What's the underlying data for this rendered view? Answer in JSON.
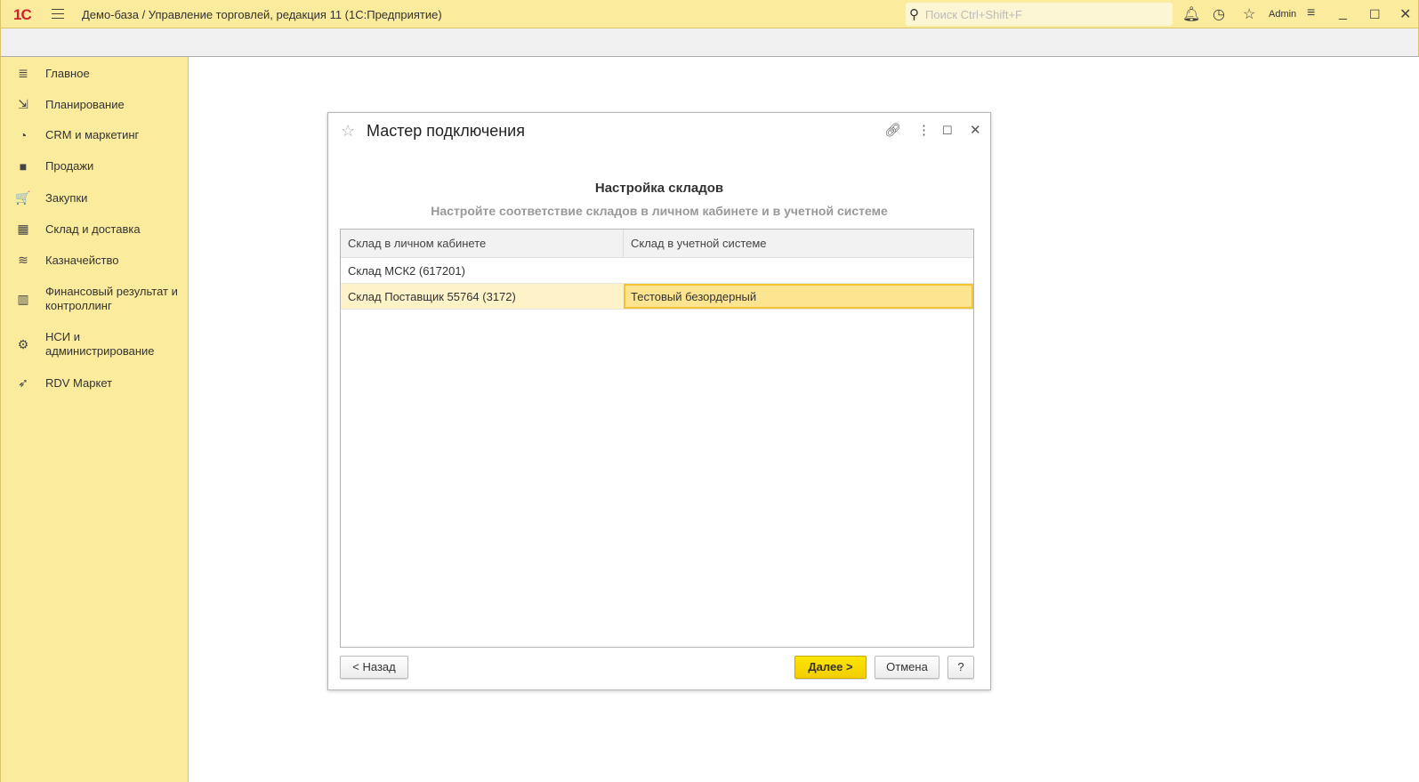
{
  "app": {
    "logo": "1С",
    "title": "Демо-база / Управление торговлей, редакция 11  (1С:Предприятие)",
    "search_placeholder": "Поиск Ctrl+Shift+F",
    "user": "Admin"
  },
  "sidebar": {
    "items": [
      {
        "label": "Главное",
        "icon": "≣"
      },
      {
        "label": "Планирование",
        "icon": "⇲"
      },
      {
        "label": "CRM и маркетинг",
        "icon": "◔"
      },
      {
        "label": "Продажи",
        "icon": "■"
      },
      {
        "label": "Закупки",
        "icon": "🛒"
      },
      {
        "label": "Склад и доставка",
        "icon": "▦"
      },
      {
        "label": "Казначейство",
        "icon": "≋"
      },
      {
        "label": "Финансовый результат и контроллинг",
        "icon": "▥"
      },
      {
        "label": "НСИ и администрирование",
        "icon": "⚙"
      },
      {
        "label": "RDV Маркет",
        "icon": "➶"
      }
    ]
  },
  "dialog": {
    "title": "Мастер подключения",
    "heading": "Настройка складов",
    "subtitle": "Настройте соответствие складов в личном кабинете и в учетной системе",
    "columns": [
      "Склад в личном кабинете",
      "Склад в учетной системе"
    ],
    "rows": [
      [
        "Склад МСК2 (617201)",
        ""
      ],
      [
        "Склад Поставщик 55764 (3172)",
        "Тестовый безордерный"
      ]
    ],
    "buttons": {
      "back": "< Назад",
      "next": "Далее >",
      "cancel": "Отмена",
      "help": "?"
    }
  }
}
